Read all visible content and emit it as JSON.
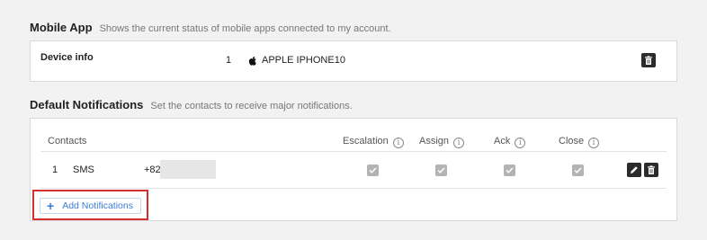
{
  "mobile_app": {
    "title": "Mobile App",
    "description": "Shows the current status of mobile apps connected to my account.",
    "device_label": "Device info",
    "device_index": "1",
    "device_name": "APPLE IPHONE10"
  },
  "notifications": {
    "title": "Default Notifications",
    "description": "Set the contacts to receive major notifications.",
    "columns": {
      "contacts": "Contacts",
      "escalation": "Escalation",
      "assign": "Assign",
      "ack": "Ack",
      "close": "Close"
    },
    "row": {
      "index": "1",
      "type": "SMS",
      "phone": "+82"
    },
    "add_button": "Add Notifications"
  },
  "colors": {
    "accent": "#3b7bd4",
    "highlight": "#d32f2f",
    "checkbox": "#b3b3b3",
    "dark_button": "#2b2b2b"
  }
}
